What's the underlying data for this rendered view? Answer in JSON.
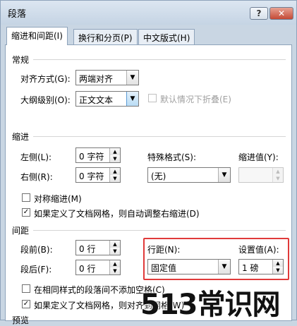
{
  "window": {
    "title": "段落",
    "help_label": "?",
    "close_label": "✕"
  },
  "tabs": [
    {
      "label": "缩进和间距(I)",
      "active": true
    },
    {
      "label": "换行和分页(P)",
      "active": false
    },
    {
      "label": "中文版式(H)",
      "active": false
    }
  ],
  "general": {
    "section_title": "常规",
    "alignment_label": "对齐方式(G):",
    "alignment_value": "两端对齐",
    "outline_label": "大纲级别(O):",
    "outline_value": "正文文本",
    "collapse_label": "默认情况下折叠(E)",
    "collapse_checked": false
  },
  "indent": {
    "section_title": "缩进",
    "left_label": "左侧(L):",
    "left_value": "0 字符",
    "right_label": "右侧(R):",
    "right_value": "0 字符",
    "special_label": "特殊格式(S):",
    "special_value": "(无)",
    "by_label": "缩进值(Y):",
    "by_value": "",
    "mirror_label": "对称缩进(M)",
    "mirror_checked": false,
    "auto_adjust_label": "如果定义了文档网格，则自动调整右缩进(D)",
    "auto_adjust_checked": true
  },
  "spacing": {
    "section_title": "间距",
    "before_label": "段前(B):",
    "before_value": "0 行",
    "after_label": "段后(F):",
    "after_value": "0 行",
    "line_spacing_label": "行距(N):",
    "line_spacing_value": "固定值",
    "at_label": "设置值(A):",
    "at_value": "1 磅",
    "no_space_label": "在相同样式的段落间不添加空格(C)",
    "no_space_checked": false,
    "snap_grid_label": "如果定义了文档网格，则对齐到网格(W)",
    "snap_grid_checked": true
  },
  "preview": {
    "section_title": "预览"
  },
  "watermark": {
    "text": "513常识网"
  },
  "colors": {
    "highlight_box": "#e03a3a",
    "panel_bg": "#ffffff",
    "window_bg": "#c9d6e3"
  }
}
